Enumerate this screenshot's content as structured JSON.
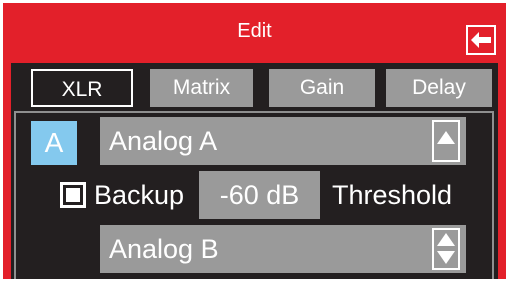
{
  "header": {
    "title": "Edit"
  },
  "tabs": [
    {
      "label": "XLR",
      "active": true
    },
    {
      "label": "Matrix",
      "active": false
    },
    {
      "label": "Gain",
      "active": false
    },
    {
      "label": "Delay",
      "active": false
    }
  ],
  "source": {
    "badge": "A",
    "primary": "Analog A",
    "backup_label": "Backup",
    "backup_checked": true,
    "threshold_value": "-60 dB",
    "threshold_label": "Threshold",
    "secondary": "Analog B"
  },
  "colors": {
    "frame": "#e3202a",
    "panel": "#231f20",
    "control": "#9a9a9a",
    "badge": "#84c9ee"
  },
  "icons": {
    "back": "arrow-left-icon",
    "up": "triangle-up-icon",
    "up_down": "triangle-up-down-icon"
  }
}
